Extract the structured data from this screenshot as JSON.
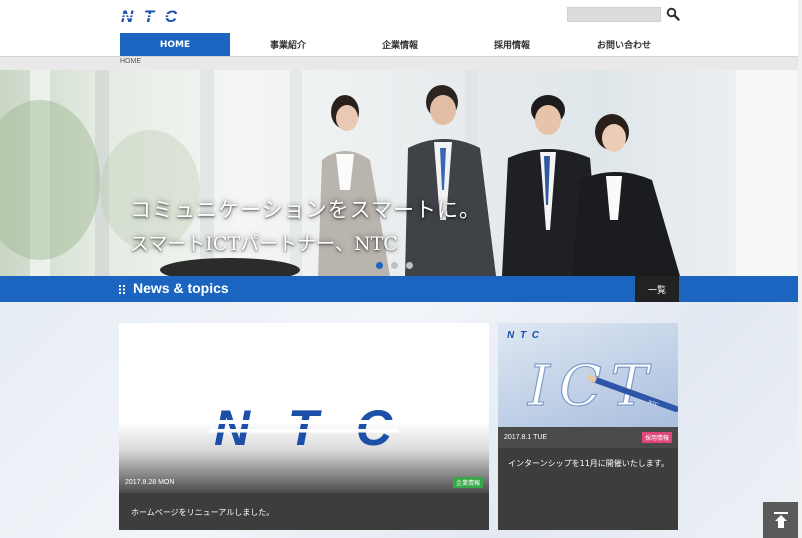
{
  "header": {
    "logo_text": "NTC",
    "search": {
      "placeholder": "",
      "value": ""
    },
    "nav": [
      {
        "label": "HOME",
        "active": true
      },
      {
        "label": "事業紹介"
      },
      {
        "label": "企業情報"
      },
      {
        "label": "採用情報"
      },
      {
        "label": "お問い合わせ"
      }
    ]
  },
  "breadcrumb": "HOME",
  "hero": {
    "caption_line1": "コミュニケーションをスマートに。",
    "caption_line2": "スマートICTパートナー、NTC",
    "slides": 3,
    "active_slide": 1
  },
  "news": {
    "title": "News & topics",
    "list_button": "一覧",
    "items": [
      {
        "date": "2017.8.28 MON",
        "tag": "企業情報",
        "tag_color": "#37a84a",
        "text": "ホームページをリニューアルしました。",
        "image_label": "NTC"
      },
      {
        "date": "2017.8.1 TUE",
        "tag": "採用情報",
        "tag_color": "#e0457a",
        "text": "インターンシップを11月に開催いたします。",
        "image_label": "ICT",
        "image_logo": "NTC"
      }
    ]
  },
  "colors": {
    "brand_blue": "#1b64bf",
    "dark_card": "#3d3d3d"
  },
  "icons": {
    "search": "search-icon",
    "pagetop": "arrow-up-icon",
    "news": "menu-dots-icon"
  }
}
